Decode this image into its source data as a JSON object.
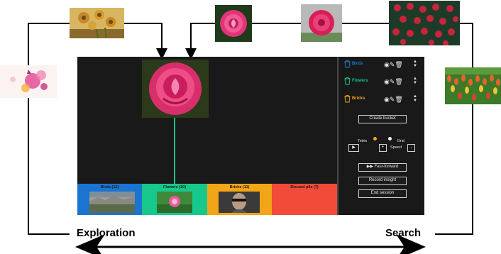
{
  "buckets": [
    {
      "name": "Birds",
      "color": "#1f78d1"
    },
    {
      "name": "Flowers",
      "color": "#19c48a"
    },
    {
      "name": "Bricks",
      "color": "#f0a31a"
    }
  ],
  "controls": {
    "create_bucket": "Create bucket",
    "tetris": "Tetris",
    "grid": "Grid",
    "play": "▶",
    "plus": "+",
    "speed": "Speed",
    "minus": "-",
    "fast_forward": "▶▶ Fast-forward",
    "record_insight": "Record insight",
    "end_session": "End session"
  },
  "trays": [
    {
      "label": "Birds (12)",
      "color": "#1b74d0"
    },
    {
      "label": "Flowers (10)",
      "color": "#17c88c"
    },
    {
      "label": "Bricks (11)",
      "color": "#f2a516"
    },
    {
      "label": "Discard pile (7)",
      "color": "#f24b3a"
    }
  ],
  "annotations": {
    "exploration": "Exploration",
    "search": "Search"
  },
  "icons": {
    "eye": "eye-icon",
    "edit": "edit-icon",
    "trash": "trash-icon",
    "updown": "chevron-up-down-icon",
    "bucket": "bucket-icon"
  }
}
